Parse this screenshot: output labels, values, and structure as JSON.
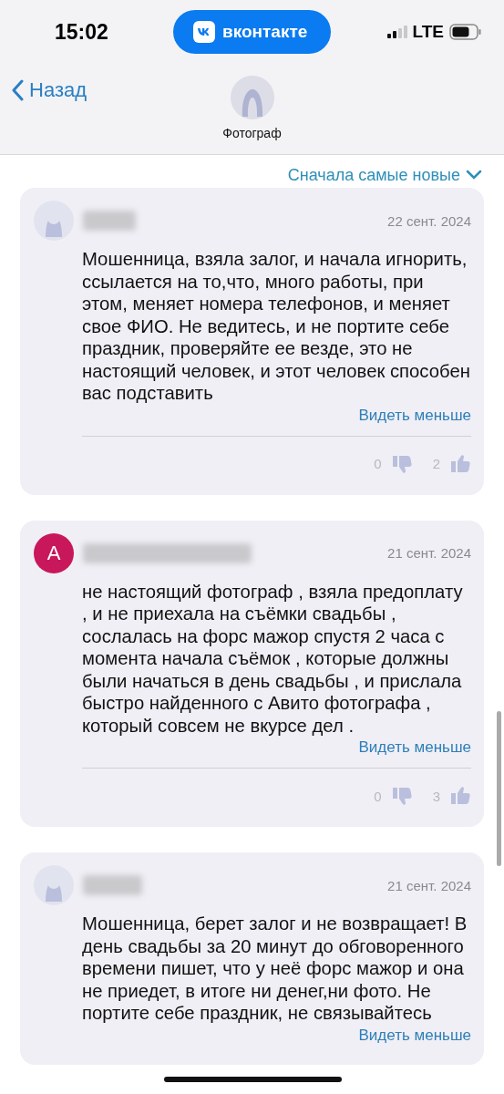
{
  "status_bar": {
    "time": "15:02",
    "app_pill": "вконтакте",
    "network": "LTE"
  },
  "nav": {
    "back": "Назад",
    "title": "Фотограф"
  },
  "sort": {
    "label": "Сначала самые новые"
  },
  "reviews": [
    {
      "avatar": {
        "kind": "silhouette"
      },
      "date": "22 сент. 2024",
      "text": "Мошенница, взяла залог, и начала игнорить, ссылается на то,что, много работы, при этом, меняет номера телефонов, и меняет свое ФИО. Не ведитесь, и не портите себе праздник, проверяйте ее везде, это не настоящий человек, и этот человек способен вас подставить",
      "toggle": "Видеть меньше",
      "reactions": {
        "dislikes": "0",
        "likes": "2"
      }
    },
    {
      "avatar": {
        "kind": "letter",
        "letter": "A",
        "color": "#c8175a"
      },
      "date": "21 сент. 2024",
      "text": "не настоящий фотограф , взяла предоплату , и не приехала на съёмки свадьбы  , сослалась на форс мажор спустя 2 часа с момента начала съёмок , которые должны были начаться в день свадьбы , и прислала быстро найденного с Авито фотографа , который совсем не вкурсе дел .",
      "toggle": "Видеть меньше",
      "reactions": {
        "dislikes": "0",
        "likes": "3"
      }
    },
    {
      "avatar": {
        "kind": "silhouette"
      },
      "date": "21 сент. 2024",
      "text": "Мошенница, берет залог и не возвращает! В день свадьбы за 20 минут до обговоренного времени пишет, что у неё форс мажор и она не приедет, в итоге ни денег,ни фото. Не портите себе праздник, не связывайтесь",
      "toggle": "Видеть меньше"
    }
  ]
}
